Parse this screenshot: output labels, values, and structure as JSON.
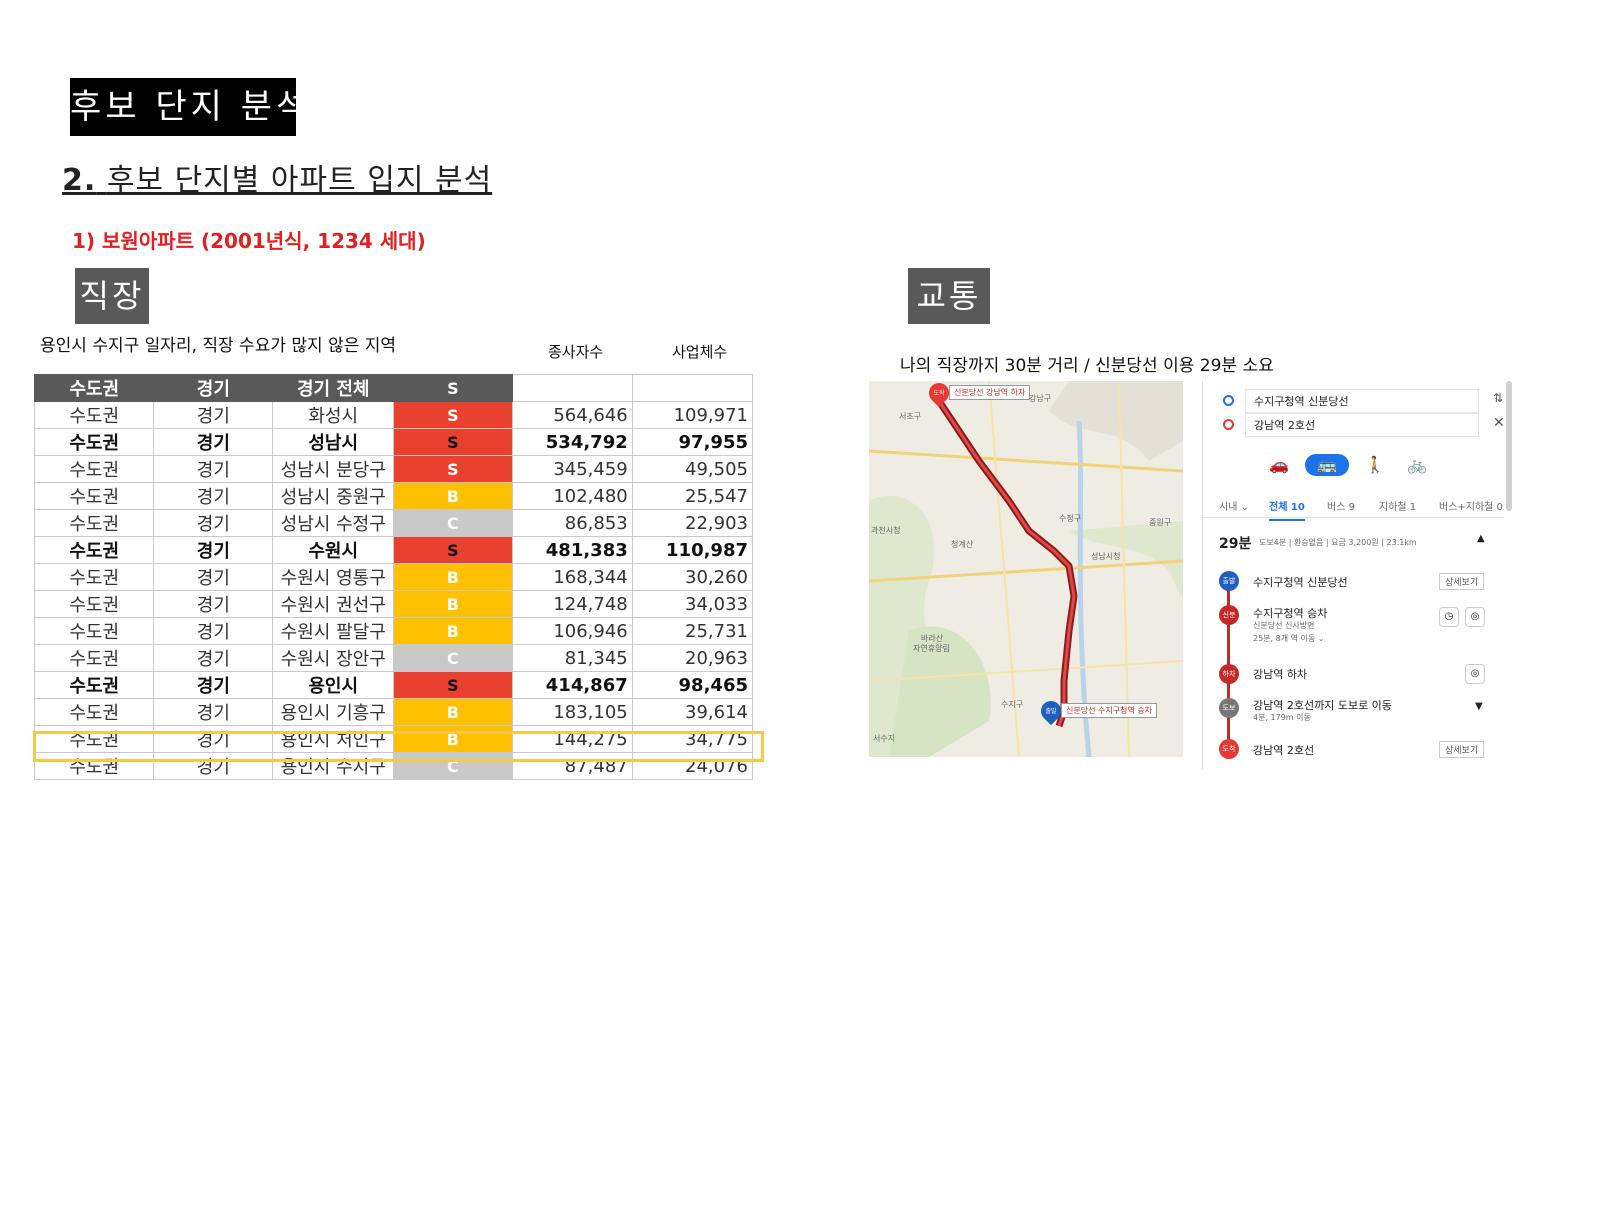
{
  "page": {
    "title": "후보 단지 분석",
    "subtitle_num": "2.",
    "subtitle_text": "후보 단지별 아파트 입지 분석",
    "section": "1) 보원아파트 (2001년식, 1234 세대)"
  },
  "job": {
    "tag": "직장",
    "note": "용인시 수지구 일자리, 직장 수요가 많지 않은 지역",
    "col_workers": "종사자수",
    "col_business": "사업체수",
    "table": {
      "header": [
        "수도권",
        "경기",
        "경기 전체",
        "S",
        "",
        ""
      ],
      "rows": [
        {
          "r": "수도권",
          "p": "경기",
          "area": "화성시",
          "grade": "S",
          "workers": "564,646",
          "biz": "109,971",
          "bold": false
        },
        {
          "r": "수도권",
          "p": "경기",
          "area": "성남시",
          "grade": "S",
          "workers": "534,792",
          "biz": "97,955",
          "bold": true
        },
        {
          "r": "수도권",
          "p": "경기",
          "area": "성남시 분당구",
          "grade": "S",
          "workers": "345,459",
          "biz": "49,505",
          "bold": false
        },
        {
          "r": "수도권",
          "p": "경기",
          "area": "성남시 중원구",
          "grade": "B",
          "workers": "102,480",
          "biz": "25,547",
          "bold": false
        },
        {
          "r": "수도권",
          "p": "경기",
          "area": "성남시 수정구",
          "grade": "C",
          "workers": "86,853",
          "biz": "22,903",
          "bold": false
        },
        {
          "r": "수도권",
          "p": "경기",
          "area": "수원시",
          "grade": "S",
          "workers": "481,383",
          "biz": "110,987",
          "bold": true
        },
        {
          "r": "수도권",
          "p": "경기",
          "area": "수원시 영통구",
          "grade": "B",
          "workers": "168,344",
          "biz": "30,260",
          "bold": false
        },
        {
          "r": "수도권",
          "p": "경기",
          "area": "수원시 권선구",
          "grade": "B",
          "workers": "124,748",
          "biz": "34,033",
          "bold": false
        },
        {
          "r": "수도권",
          "p": "경기",
          "area": "수원시 팔달구",
          "grade": "B",
          "workers": "106,946",
          "biz": "25,731",
          "bold": false
        },
        {
          "r": "수도권",
          "p": "경기",
          "area": "수원시 장안구",
          "grade": "C",
          "workers": "81,345",
          "biz": "20,963",
          "bold": false
        },
        {
          "r": "수도권",
          "p": "경기",
          "area": "용인시",
          "grade": "S",
          "workers": "414,867",
          "biz": "98,465",
          "bold": true
        },
        {
          "r": "수도권",
          "p": "경기",
          "area": "용인시 기흥구",
          "grade": "B",
          "workers": "183,105",
          "biz": "39,614",
          "bold": false
        },
        {
          "r": "수도권",
          "p": "경기",
          "area": "용인시 처인구",
          "grade": "B",
          "workers": "144,275",
          "biz": "34,775",
          "bold": false
        },
        {
          "r": "수도권",
          "p": "경기",
          "area": "용인시 수지구",
          "grade": "C",
          "workers": "87,487",
          "biz": "24,076",
          "bold": false
        }
      ]
    }
  },
  "traffic": {
    "tag": "교통",
    "note": "나의 직장까지 30분 거리 / 신분당선 이용 29분 소요",
    "map": {
      "end_label": "신분당선 강남역 하차",
      "start_label": "신분당선 수지구청역 승차",
      "places": [
        "강남구",
        "서초구",
        "성남시청",
        "수정구",
        "중원구",
        "과천시청",
        "청계산",
        "바라산",
        "자연휴양림",
        "수지구",
        "서수지"
      ],
      "end_pin": "도착",
      "start_pin": "출발"
    },
    "panel": {
      "from": "수지구청역 신분당선",
      "to": "강남역 2호선",
      "filters": [
        "시내 ⌄",
        "전체 10",
        "버스 9",
        "지하철 1",
        "버스+지하철 0"
      ],
      "summary_time": "29분",
      "summary_detail": "도보4분 | 환승없음 | 요금 3,200원 | 23.1km",
      "steps": [
        {
          "badge": "출발",
          "text": "수지구청역 신분당선",
          "sub": "",
          "btn": "상세보기"
        },
        {
          "badge": "신분",
          "text": "수지구청역 승차",
          "sub": "신분당선 신사방면",
          "sub2": "25분, 8개 역 이동 ⌄",
          "btn": ""
        },
        {
          "badge": "하차",
          "text": "강남역 하차",
          "sub": "",
          "btn": ""
        },
        {
          "badge": "도보",
          "text": "강남역 2호선까지 도보로 이동",
          "sub": "4분, 179m 이동",
          "btn": ""
        },
        {
          "badge": "도착",
          "text": "강남역 2호선",
          "sub": "",
          "btn": "상세보기"
        }
      ]
    }
  },
  "colors": {
    "grade_S": "#e8412f",
    "grade_B": "#ffc000",
    "grade_C": "#c9c9c9",
    "route": "#c62828",
    "accent": "#1a73e8"
  }
}
